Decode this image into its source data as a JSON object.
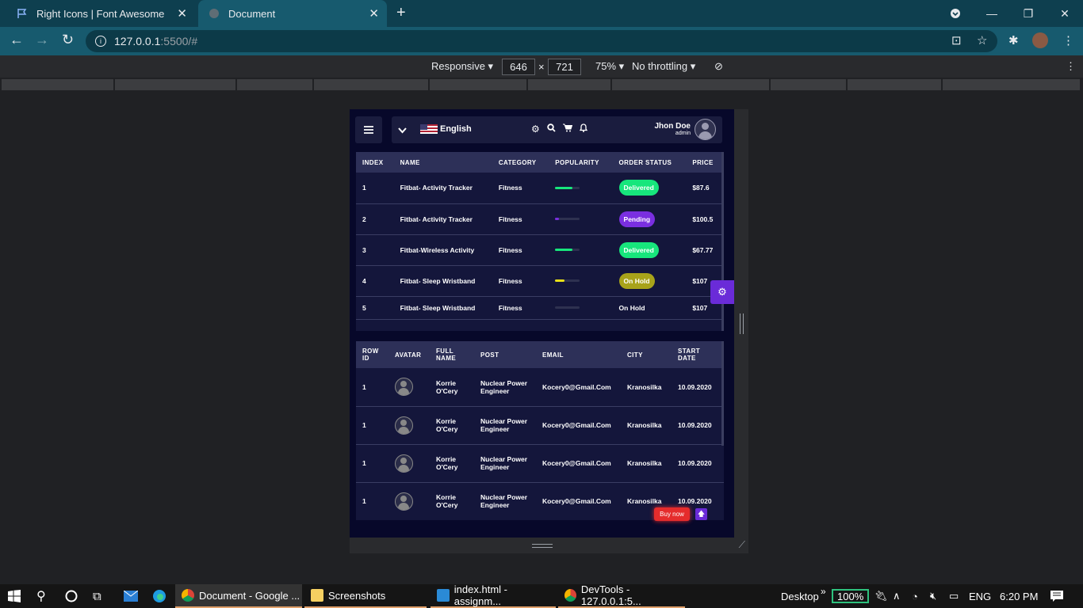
{
  "browser": {
    "tabs": [
      {
        "title": "Right Icons | Font Awesome",
        "active": false
      },
      {
        "title": "Document",
        "active": true
      }
    ],
    "url_host": "127.0.0.1",
    "url_path": ":5500/#"
  },
  "devtools": {
    "mode": "Responsive",
    "width": "646",
    "height": "721",
    "zoom": "75%",
    "throttle": "No throttling",
    "times": "×"
  },
  "app": {
    "language": "English",
    "user_name": "Jhon Doe",
    "user_role": "admin",
    "orders_table": {
      "headers": [
        "INDEX",
        "NAME",
        "CATEGORY",
        "POPULARITY",
        "ORDER STATUS",
        "PRICE"
      ],
      "rows": [
        {
          "index": "1",
          "name": "Fitbat- Activity Tracker",
          "category": "Fitness",
          "popularity": 0.7,
          "popularity_color": "#17e67c",
          "status": "Delivered",
          "status_color": "#17e67c",
          "price": "$87.6"
        },
        {
          "index": "2",
          "name": "Fitbat- Activity Tracker",
          "category": "Fitness",
          "popularity": 0.15,
          "popularity_color": "#7a2fe0",
          "status": "Pending",
          "status_color": "#7a2fe0",
          "price": "$100.5"
        },
        {
          "index": "3",
          "name": "Fitbat-Wireless Activity",
          "category": "Fitness",
          "popularity": 0.7,
          "popularity_color": "#17e67c",
          "status": "Delivered",
          "status_color": "#17e67c",
          "price": "$67.77"
        },
        {
          "index": "4",
          "name": "Fitbat- Sleep Wristband",
          "category": "Fitness",
          "popularity": 0.4,
          "popularity_color": "#e8e018",
          "status": "On Hold",
          "status_color": "#a8a31a",
          "price": "$107"
        },
        {
          "index": "5",
          "name": "Fitbat- Sleep Wristband",
          "category": "Fitness",
          "popularity": 0.0,
          "popularity_color": "#2e3150",
          "status": "On Hold",
          "status_color": "",
          "price": "$107"
        }
      ]
    },
    "users_table": {
      "headers": [
        "ROW ID",
        "AVATAR",
        "FULL NAME",
        "POST",
        "EMAIL",
        "CITY",
        "START DATE"
      ],
      "rows": [
        {
          "id": "1",
          "name": "Korrie O'Cery",
          "post": "Nuclear Power Engineer",
          "email": "Kocery0@Gmail.Com",
          "city": "Kranosilka",
          "date": "10.09.2020"
        },
        {
          "id": "1",
          "name": "Korrie O'Cery",
          "post": "Nuclear Power Engineer",
          "email": "Kocery0@Gmail.Com",
          "city": "Kranosilka",
          "date": "10.09.2020"
        },
        {
          "id": "1",
          "name": "Korrie O'Cery",
          "post": "Nuclear Power Engineer",
          "email": "Kocery0@Gmail.Com",
          "city": "Kranosilka",
          "date": "10.09.2020"
        },
        {
          "id": "1",
          "name": "Korrie O'Cery",
          "post": "Nuclear Power Engineer",
          "email": "Kocery0@Gmail.Com",
          "city": "Kranosilka",
          "date": "10.09.2020"
        }
      ]
    },
    "buy_now_label": "Buy now"
  },
  "taskbar": {
    "apps": [
      {
        "label": "Document - Google ...",
        "active": true
      },
      {
        "label": "Screenshots",
        "active": false
      },
      {
        "label": "index.html - assignm...",
        "active": false
      },
      {
        "label": "DevTools - 127.0.0.1:5...",
        "active": false
      }
    ],
    "desktop_label": "Desktop",
    "battery": "100%",
    "lang": "ENG",
    "time": "6:20 PM"
  }
}
